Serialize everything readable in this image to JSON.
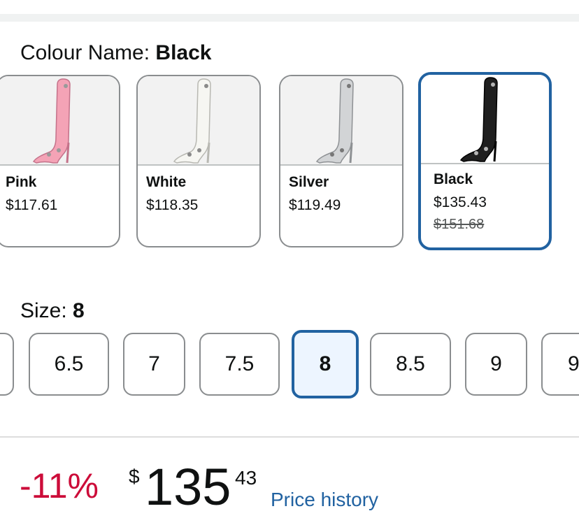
{
  "colour": {
    "label": "Colour Name:",
    "value": "Black"
  },
  "swatches": [
    {
      "name": "Pink",
      "price": "$117.61",
      "color": "#f4a3b6"
    },
    {
      "name": "White",
      "price": "$118.35",
      "color": "#f3f3ef"
    },
    {
      "name": "Silver",
      "price": "$119.49",
      "color": "#cfd1d3"
    },
    {
      "name": "Black",
      "price": "$135.43",
      "was": "$151.68",
      "color": "#1f1f1f"
    }
  ],
  "size": {
    "label": "Size:",
    "value": "8",
    "options": [
      "6.5",
      "7",
      "7.5",
      "8",
      "8.5",
      "9",
      "9"
    ]
  },
  "pricing": {
    "discount": "-11%",
    "currency": "$",
    "whole": "135",
    "fraction": "43",
    "history_link": "Price history"
  },
  "colors": {
    "accent": "#2162a1",
    "deal": "#cc0c39"
  }
}
